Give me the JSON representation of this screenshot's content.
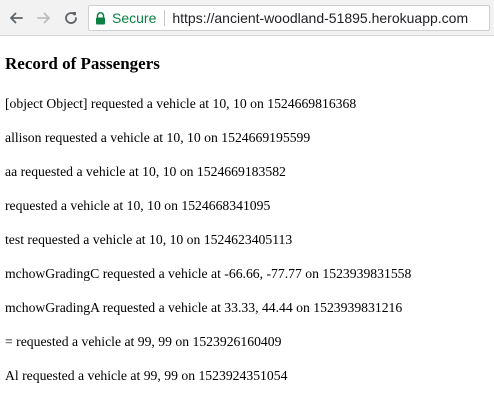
{
  "browser": {
    "secure_label": "Secure",
    "url": "https://ancient-woodland-51895.herokuapp.com",
    "icons": [
      "back-arrow-icon",
      "forward-arrow-icon",
      "reload-icon",
      "lock-icon"
    ],
    "colors": {
      "secure": "#0b8043"
    }
  },
  "page": {
    "title": "Record of Passengers",
    "records": [
      "[object Object] requested a vehicle at 10, 10 on 1524669816368",
      "allison requested a vehicle at 10, 10 on 1524669195599",
      "aa requested a vehicle at 10, 10 on 1524669183582",
      " requested a vehicle at 10, 10 on 1524668341095",
      "test requested a vehicle at 10, 10 on 1524623405113",
      "mchowGradingC requested a vehicle at -66.66, -77.77 on 1523939831558",
      "mchowGradingA requested a vehicle at 33.33, 44.44 on 1523939831216",
      "= requested a vehicle at 99, 99 on 1523926160409",
      "Al requested a vehicle at 99, 99 on 1523924351054"
    ]
  }
}
